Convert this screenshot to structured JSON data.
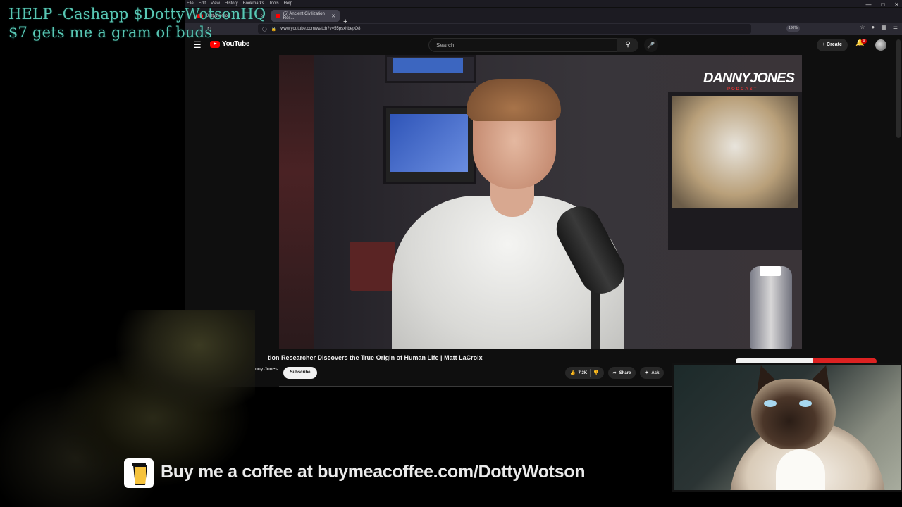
{
  "overlay": {
    "line1": "HELP -Cashapp $DottyWotsonHQ",
    "line2": "$7 gets me a gram of buds"
  },
  "browser": {
    "menu": [
      "File",
      "Edit",
      "View",
      "History",
      "Bookmarks",
      "Tools",
      "Help"
    ],
    "tabs": [
      {
        "label": "DottyWotson",
        "active": false
      },
      {
        "label": "(5) Ancient Civilization Res...",
        "active": true
      }
    ],
    "url": "www.youtube.com/watch?v=55psxhbepO8",
    "zoom": "130%"
  },
  "youtube": {
    "logo_text": "YouTube",
    "search_placeholder": "Search",
    "create_label": "Create",
    "notification_count": "9",
    "video": {
      "title": "tion Researcher Discovers the True Origin of Human Life | Matt LaCroix",
      "channel": "nny Jones",
      "subscribe_label": "Subscribe",
      "likes": "7.3K",
      "share_label": "Share",
      "ask_label": "Ask",
      "brand_top": "DANNYJONES",
      "brand_sub": "PODCAST"
    }
  },
  "banner": {
    "coffee_text": "Buy me a coffee at buymeacoffee.com/DottyWotson"
  },
  "colors": {
    "overlay_text": "#59c7b4",
    "youtube_red": "#ff0000",
    "bg": "#0f0f0f"
  }
}
